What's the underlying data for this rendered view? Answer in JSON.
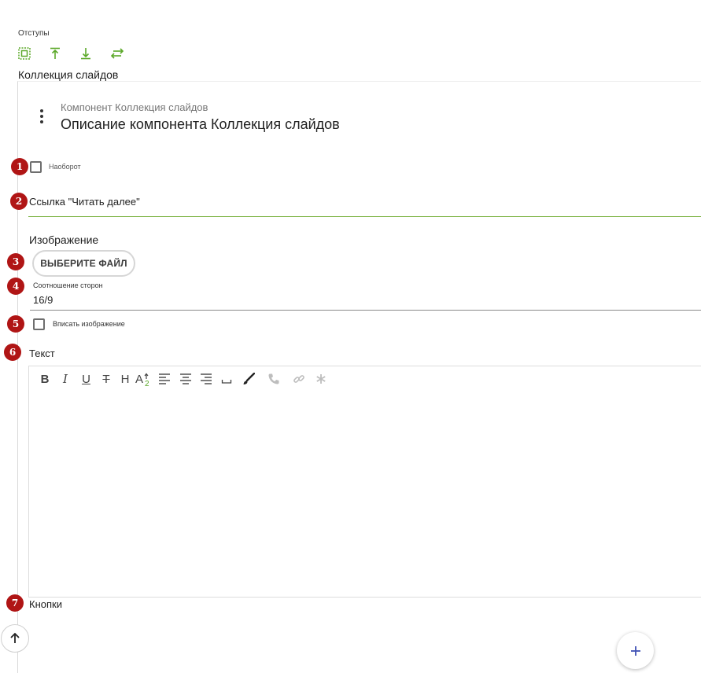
{
  "spacing": {
    "label": "Отступы",
    "icons": [
      "padding-all-icon",
      "align-top-icon",
      "align-bottom-icon",
      "swap-horizontal-icon"
    ]
  },
  "collection": {
    "label": "Коллекция слайдов"
  },
  "component": {
    "subtitle": "Компонент Коллекция слайдов",
    "title": "Описание компонента Коллекция слайдов"
  },
  "badges": [
    "1",
    "2",
    "3",
    "4",
    "5",
    "6",
    "7"
  ],
  "fields": {
    "reverse": {
      "label": "Наоборот",
      "checked": false
    },
    "read_more": {
      "label": "Ссылка \"Читать далее\"",
      "value": ""
    },
    "image": {
      "label": "Изображение",
      "button": "ВЫБЕРИТЕ ФАЙЛ"
    },
    "aspect": {
      "label": "Соотношение сторон",
      "value": "16/9"
    },
    "fit": {
      "label": "Вписать изображение",
      "checked": false
    },
    "text": {
      "label": "Текст"
    },
    "buttons": {
      "label": "Кнопки"
    }
  },
  "toolbar": {
    "bold": "B",
    "italic": "I",
    "underline": "U",
    "strike": "T",
    "heading": "H"
  },
  "colors": {
    "accent_green": "#5ba829",
    "badge_red": "#b01515",
    "fab_icon": "#3f51b5"
  }
}
